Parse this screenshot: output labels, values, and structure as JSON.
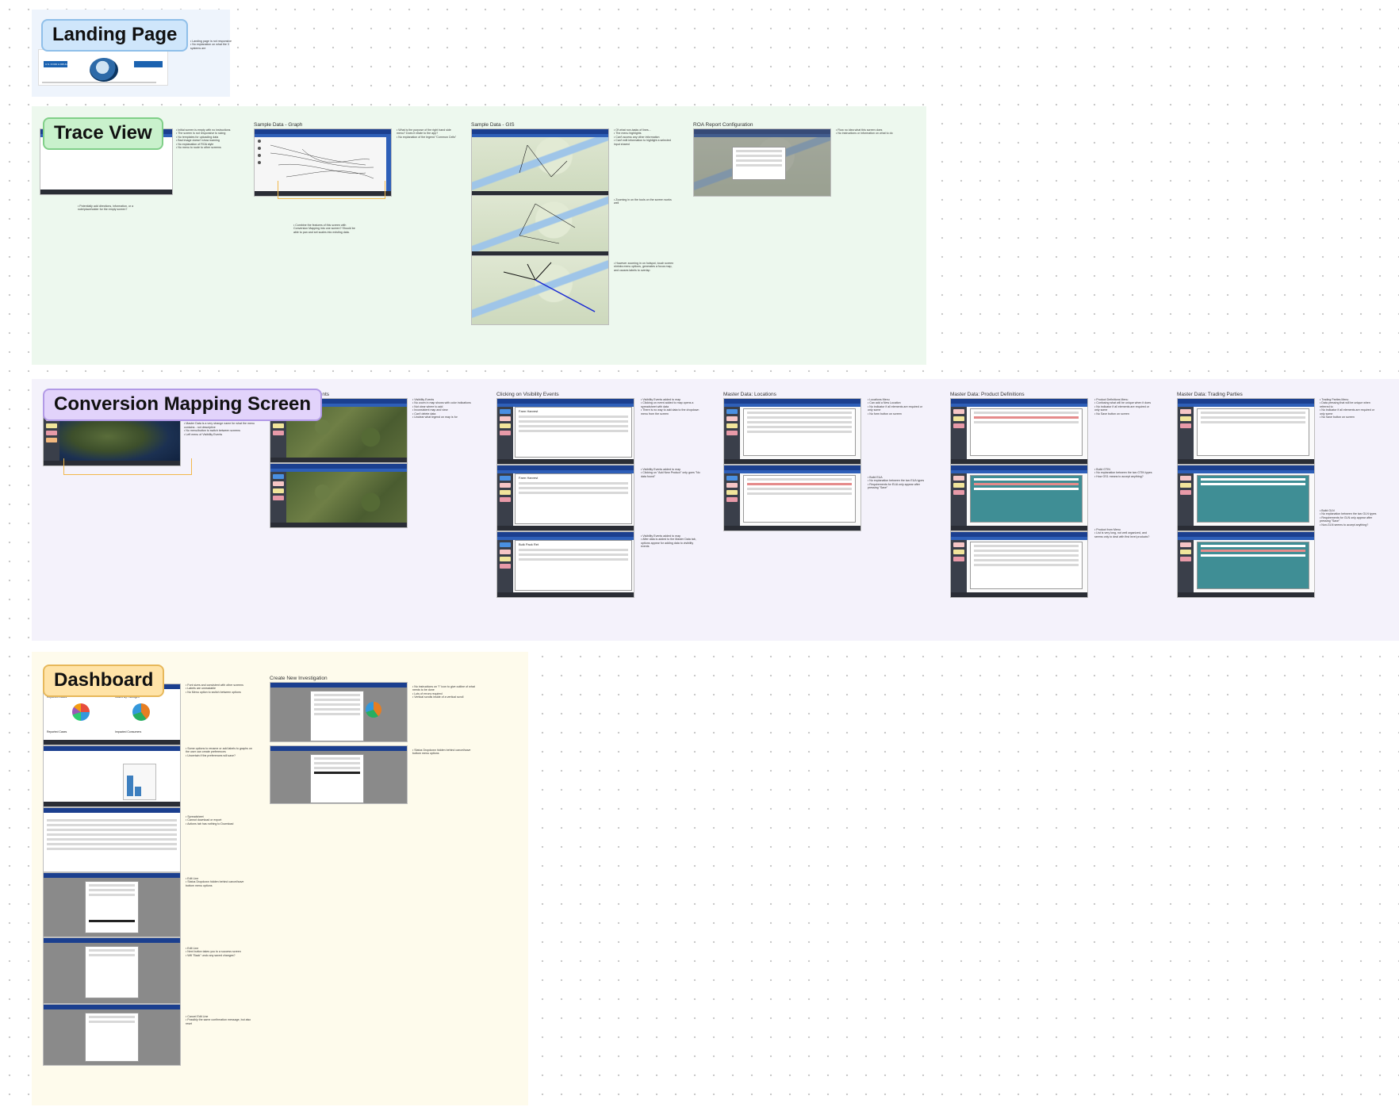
{
  "sections": {
    "landing": {
      "title": "Landing Page",
      "notes": [
        "Landing page is not responsive",
        "No explanation on what the 3 systems are"
      ],
      "logo_text": "U.S. FOOD & DRUG"
    },
    "trace": {
      "title": "Trace View",
      "frames": {
        "graph": "Sample Data - Graph",
        "gis": "Sample Data - GIS",
        "roa": "ROA Report Configuration"
      },
      "notes_initial": [
        "Initial screen is empty with no instructions",
        "The screen is not responsive to sizing",
        "No templates for uploading data",
        "Bad image doesn't show warning",
        "No explanation of ROA style",
        "No menu to route to other screens"
      ],
      "note_below_initial": "Potentially add directions, information, or a note/placeholder for the empty screen?",
      "notes_graph": [
        "What is the purpose of the right hand side menu? Does it relate to the app?",
        "No explanation of the legend \"Common Cells\""
      ],
      "note_below_graph": "Combine the features of this screen with Conversion Mapping into one screen? Should be able to pan and set scales into existing data.",
      "notes_gis": [
        "Of what non-tasks of lines...",
        "The menu highlights",
        "Can't access any other information",
        "Can't edit information to highlight a selected input shared"
      ],
      "notes_gis_zoom": [
        "Zooming in on the tools on the screen works well"
      ],
      "notes_gis_bottom": [
        "However zooming in on hotspot, touch screen shrinks menu options, generates a focus map, and causes labels to overlap"
      ],
      "notes_roa": [
        "Flow no idea what this screen does",
        "No instructions or information on what to do"
      ]
    },
    "conversion": {
      "title": "Conversion Mapping Screen",
      "frames": {
        "visibility": "Visibility Events",
        "clicking": "Clicking on Visibility Events",
        "locations": "Master Data: Locations",
        "products": "Master Data: Product Definitions",
        "trading": "Master Data: Trading Parties"
      },
      "notes_main": [
        "No information on what EPCs is",
        "Master Data is a very strange name for what the menu contains - not descriptive",
        "No menu/button to switch between screens",
        "Left menu of Visibility Events"
      ],
      "notes_visibility": [
        "Visibility Events",
        "No zoom in map shows with color indications",
        "Not clear where to add",
        "Inconsistent map and view",
        "Can't delete data",
        "Unclear what legend on map is for"
      ],
      "notes_clicking": [
        "Visibility Events added to map",
        "Clicking on event added to map opens a spreadsheet with data",
        "There is no way to add data to the dropdown menu from the screen"
      ],
      "notes_clicking_2": [
        "Visibility Events added to map",
        "Clicking on \"Add New Product\" only goes \"No data found\""
      ],
      "notes_clicking_3": [
        "Visibility Events added to map",
        "After data is added to the Master Data tab, options appear for adding data to visibility events"
      ],
      "notes_locations": [
        "Locations Menu",
        "Can add a New Location",
        "No indicator if all elements are required or only some",
        "No form button on screen"
      ],
      "notes_locations_2": [
        "Build EUA",
        "No explanation between the two EUA types",
        "Requirements for EUA only appear after pressing \"Save\""
      ],
      "notes_products": [
        "Product Definitions Menu",
        "Confusing what will be unique when it does",
        "No indicator if all elements are required or only some",
        "No Save button on screen"
      ],
      "notes_products_2": [
        "Build GTIN",
        "No explanation between the two GTIN types",
        "How GS1 means to accept anything?"
      ],
      "notes_products_3": [
        "Product from Menu",
        "List is very long, not well organized, and seems only to deal with first level products?"
      ],
      "notes_trading": [
        "Trading Parties Menu",
        "Data pressing that will be unique when referred to",
        "No indicator if all elements are required or only some",
        "No Save button on screen"
      ],
      "notes_trading_2": [
        "Build GLN",
        "No explanation between the two GLN types",
        "Requirements for GLN only appear after pressing \"Save\"",
        "Non-GLN seems to accept anything?"
      ],
      "shot_titles": [
        "Farm Harvest",
        "Farm Harvest",
        "Bulk Pack Ret"
      ]
    },
    "dashboard": {
      "title": "Dashboard",
      "frame_create": "Create New Investigation",
      "notes_1": [
        "Font sizes and consistent with other screens",
        "Labels are unreadable",
        "No Menu option to switch between options"
      ],
      "notes_2": [
        "Some options to rename or add labels to graphs on the user can create preferences",
        "Uncertain if the preferences will save?"
      ],
      "notes_3": [
        "Spreadsheet",
        "Cannot download or export",
        "Actions tab has nothing to Download"
      ],
      "notes_4": [
        "Edit Line",
        "Status Dropdown hidden behind cancel/save bottom menu options"
      ],
      "notes_5": [
        "Edit Line",
        "Next button takes you to a success screen",
        "Will \"Back\" undo any saved changes?"
      ],
      "notes_6": [
        "Cancel Edit Line",
        "Possibly the same confirmation message, but also reset"
      ],
      "notes_create": [
        "No instructions on \"i\" icon to give outline of what needs to be done",
        "Lots of errors required",
        "Vertical scrolls inside of a vertical scroll"
      ],
      "notes_create_2": [
        "Status Dropdown hidden behind cancel/save bottom menu options"
      ],
      "chart_titles": [
        "Reported Cases",
        "Cases By Pathogen",
        "Reported Cases",
        "Impacted Consumers"
      ]
    }
  },
  "colors": {
    "nav": "#1b3f8f",
    "landing_bg": "#eef4fc",
    "trace_bg": "#edf8ee",
    "conv_bg": "#f4f2fb",
    "dash_bg": "#fefbec"
  }
}
